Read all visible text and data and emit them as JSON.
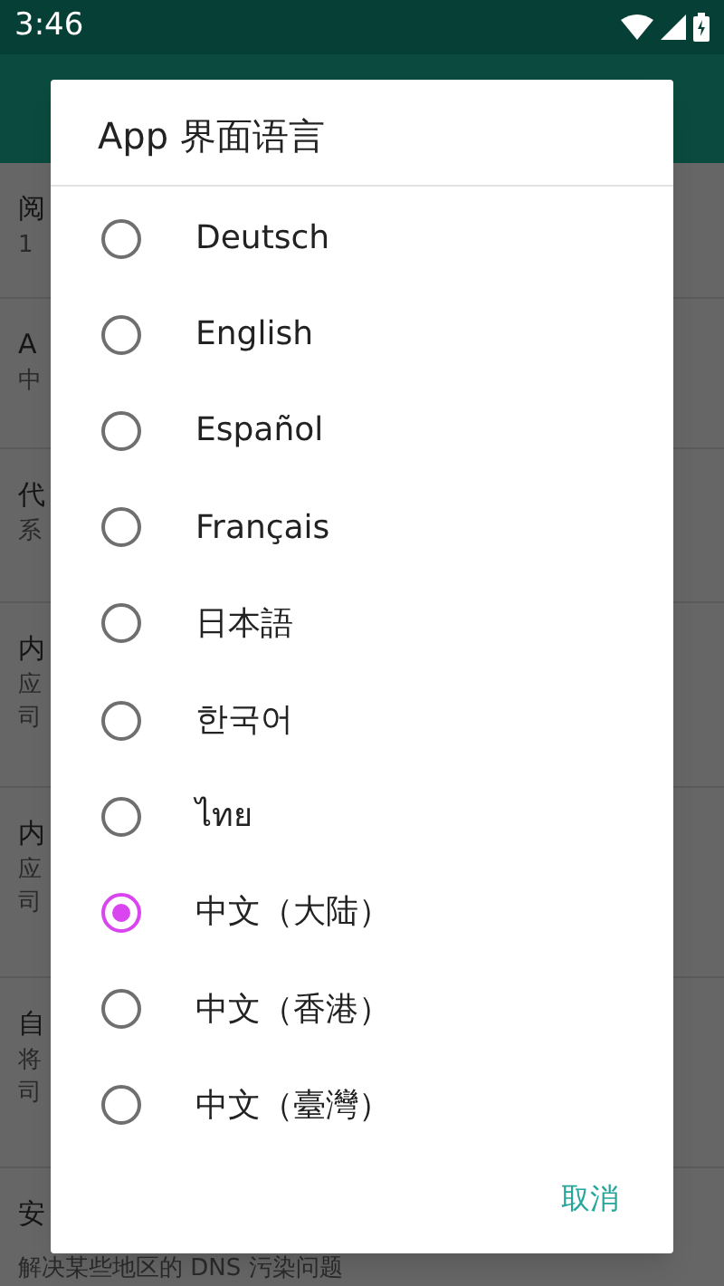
{
  "status_bar": {
    "time": "3:46"
  },
  "background_settings": [
    {
      "title": "阅",
      "subtitle_lines": [
        "1"
      ]
    },
    {
      "title": "A",
      "subtitle_lines": [
        "中"
      ]
    },
    {
      "title": "代",
      "subtitle_lines": [
        "系"
      ]
    },
    {
      "title": "内",
      "subtitle_lines": [
        "应",
        "司"
      ]
    },
    {
      "title": "内",
      "subtitle_lines": [
        "应",
        "司"
      ]
    },
    {
      "title": "自",
      "subtitle_lines": [
        "将",
        "司"
      ]
    },
    {
      "title": "安",
      "subtitle_lines": [
        "解决某些地区的 DNS 污染问题"
      ]
    }
  ],
  "dialog": {
    "title": "App 界面语言",
    "options": [
      {
        "label": "Deutsch",
        "selected": false
      },
      {
        "label": "English",
        "selected": false
      },
      {
        "label": "Español",
        "selected": false
      },
      {
        "label": "Français",
        "selected": false
      },
      {
        "label": "日本語",
        "selected": false
      },
      {
        "label": "한국어",
        "selected": false
      },
      {
        "label": "ไทย",
        "selected": false
      },
      {
        "label": "中文（大陆）",
        "selected": true
      },
      {
        "label": "中文（香港）",
        "selected": false
      },
      {
        "label": "中文（臺灣）",
        "selected": false
      }
    ],
    "cancel": "取消"
  }
}
